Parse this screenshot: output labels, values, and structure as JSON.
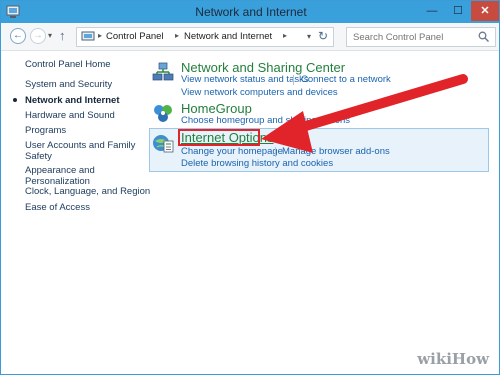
{
  "window": {
    "title": "Network and Internet",
    "minimize_glyph": "—",
    "maximize_glyph": "☐",
    "close_glyph": "✕"
  },
  "nav": {
    "back_glyph": "←",
    "forward_glyph": "→",
    "dropdown_glyph": "▾",
    "up_glyph": "↑",
    "breadcrumbs": [
      "Control Panel",
      "Network and Internet"
    ],
    "crumb_separator": "▸",
    "refresh_glyph": "↻",
    "search_placeholder": "Search Control Panel"
  },
  "sidebar": {
    "items": [
      {
        "label": "Control Panel Home",
        "active": false
      },
      {
        "label": "System and Security",
        "active": false
      },
      {
        "label": "Network and Internet",
        "active": true
      },
      {
        "label": "Hardware and Sound",
        "active": false
      },
      {
        "label": "Programs",
        "active": false
      },
      {
        "label": "User Accounts and Family",
        "label2": "Safety",
        "active": false
      },
      {
        "label": "Appearance and",
        "label2": "Personalization",
        "active": false
      },
      {
        "label": "Clock, Language, and Region",
        "active": false
      },
      {
        "label": "Ease of Access",
        "active": false
      }
    ]
  },
  "categories": [
    {
      "title": "Network and Sharing Center",
      "icon": "network-sharing-icon",
      "links": [
        "View network status and tasks",
        "Connect to a network",
        "View network computers and devices"
      ]
    },
    {
      "title": "HomeGroup",
      "icon": "homegroup-icon",
      "links": [
        "Choose homegroup and sharing options"
      ]
    },
    {
      "title": "Internet Options",
      "icon": "internet-options-icon",
      "links": [
        "Change your homepage",
        "Manage browser add-ons",
        "Delete browsing history and cookies"
      ]
    }
  ],
  "watermark": "wikiHow",
  "colors": {
    "titlebar": "#3aa0dc",
    "category_title": "#23803c",
    "link": "#1b63b0",
    "highlight_fill": "#e7f2fb",
    "annotation_red": "#e0242a"
  }
}
